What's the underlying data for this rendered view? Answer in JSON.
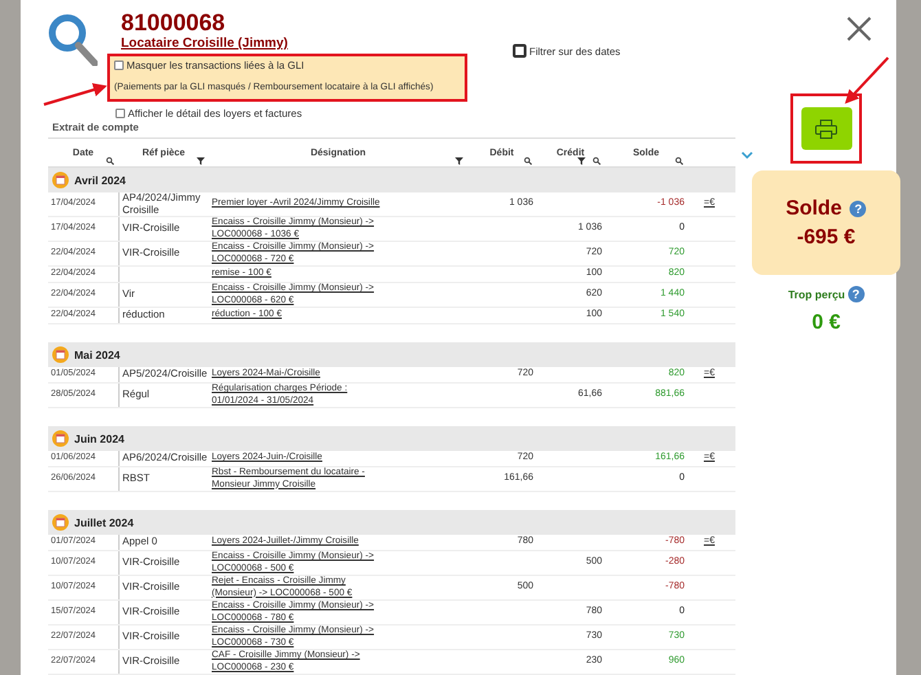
{
  "header": {
    "account_number": "81000068",
    "tenant": "Locataire Croisille (Jimmy)"
  },
  "gli_option": {
    "label": "Masquer les transactions liées à la GLI",
    "note": "(Paiements par la GLI masqués / Remboursement locataire à la GLI affichés)",
    "checked": false
  },
  "date_filter": {
    "label": "Filtrer sur des dates",
    "checked": false
  },
  "detail_option": {
    "label": "Afficher le détail des loyers et factures",
    "checked": false
  },
  "section_title": "Extrait de compte",
  "table": {
    "columns": [
      "Date",
      "Réf pièce",
      "Désignation",
      "Débit",
      "Crédit",
      "Solde"
    ],
    "groups": [
      {
        "month": "Avril 2024",
        "rows": [
          {
            "date": "17/04/2024",
            "ref": "AP4/2024/Jimmy Croisille",
            "designation": "Premier loyer -Avril 2024/Jimmy Croisille",
            "debit": "1 036",
            "credit": "",
            "balance": "-1 036",
            "color": "#a52a2a",
            "action": "=€"
          },
          {
            "date": "17/04/2024",
            "ref": "VIR-Croisille",
            "designation": "Encaiss - Croisille Jimmy (Monsieur) -> LOC000068 - 1036 €",
            "debit": "",
            "credit": "1 036",
            "balance": "0",
            "color": "#222222",
            "action": ""
          },
          {
            "date": "22/04/2024",
            "ref": "VIR-Croisille",
            "designation": "Encaiss - Croisille Jimmy (Monsieur) -> LOC000068 - 720 €",
            "debit": "",
            "credit": "720",
            "balance": "720",
            "color": "#2e9a2e",
            "action": ""
          },
          {
            "date": "22/04/2024",
            "ref": "",
            "designation": "remise - 100 €",
            "debit": "",
            "credit": "100",
            "balance": "820",
            "color": "#2e9a2e",
            "action": ""
          },
          {
            "date": "22/04/2024",
            "ref": "Vir",
            "designation": "Encaiss - Croisille Jimmy (Monsieur) -> LOC000068 - 620 €",
            "debit": "",
            "credit": "620",
            "balance": "1 440",
            "color": "#2e9a2e",
            "action": ""
          },
          {
            "date": "22/04/2024",
            "ref": "réduction",
            "designation": "réduction - 100 €",
            "debit": "",
            "credit": "100",
            "balance": "1 540",
            "color": "#2e9a2e",
            "action": ""
          }
        ]
      },
      {
        "month": "Mai 2024",
        "rows": [
          {
            "date": "01/05/2024",
            "ref": "AP5/2024/Croisille",
            "designation": "Loyers 2024-Mai-/Croisille",
            "debit": "720",
            "credit": "",
            "balance": "820",
            "color": "#2e9a2e",
            "action": "=€"
          },
          {
            "date": "28/05/2024",
            "ref": "Régul",
            "designation": "Régularisation charges Période : 01/01/2024 - 31/05/2024",
            "debit": "",
            "credit": "61,66",
            "balance": "881,66",
            "color": "#2e9a2e",
            "action": ""
          }
        ]
      },
      {
        "month": "Juin 2024",
        "rows": [
          {
            "date": "01/06/2024",
            "ref": "AP6/2024/Croisille",
            "designation": "Loyers 2024-Juin-/Croisille",
            "debit": "720",
            "credit": "",
            "balance": "161,66",
            "color": "#2e9a2e",
            "action": "=€"
          },
          {
            "date": "26/06/2024",
            "ref": "RBST",
            "designation": "Rbst - Remboursement du locataire -Monsieur Jimmy Croisille",
            "debit": "161,66",
            "credit": "",
            "balance": "0",
            "color": "#222222",
            "action": ""
          }
        ]
      },
      {
        "month": "Juillet 2024",
        "rows": [
          {
            "date": "01/07/2024",
            "ref": "Appel 0",
            "designation": "Loyers 2024-Juillet-/Jimmy Croisille",
            "debit": "780",
            "credit": "",
            "balance": "-780",
            "color": "#a52a2a",
            "action": "=€"
          },
          {
            "date": "10/07/2024",
            "ref": "VIR-Croisille",
            "designation": "Encaiss - Croisille Jimmy (Monsieur) -> LOC000068 - 500 €",
            "debit": "",
            "credit": "500",
            "balance": "-280",
            "color": "#a52a2a",
            "action": ""
          },
          {
            "date": "10/07/2024",
            "ref": "VIR-Croisille",
            "designation": "Rejet - Encaiss - Croisille Jimmy (Monsieur) -> LOC000068 - 500 €",
            "debit": "500",
            "credit": "",
            "balance": "-780",
            "color": "#a52a2a",
            "action": ""
          },
          {
            "date": "15/07/2024",
            "ref": "VIR-Croisille",
            "designation": "Encaiss - Croisille Jimmy (Monsieur) -> LOC000068 - 780 €",
            "debit": "",
            "credit": "780",
            "balance": "0",
            "color": "#222222",
            "action": ""
          },
          {
            "date": "22/07/2024",
            "ref": "VIR-Croisille",
            "designation": "Encaiss - Croisille Jimmy (Monsieur) -> LOC000068 - 730 €",
            "debit": "",
            "credit": "730",
            "balance": "730",
            "color": "#2e9a2e",
            "action": ""
          },
          {
            "date": "22/07/2024",
            "ref": "VIR-Croisille",
            "designation": "CAF - Croisille Jimmy (Monsieur) -> LOC000068 - 230 €",
            "debit": "",
            "credit": "230",
            "balance": "960",
            "color": "#2e9a2e",
            "action": ""
          }
        ]
      }
    ]
  },
  "summary": {
    "balance_label": "Solde",
    "balance_help": "?",
    "balance": "-695 €",
    "overpaid_label": "Trop perçu",
    "overpaid_help": "?",
    "overpaid": "0 €"
  }
}
